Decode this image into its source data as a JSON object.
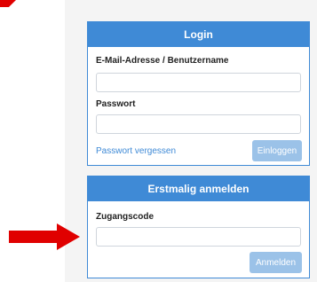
{
  "login": {
    "title": "Login",
    "username_label": "E-Mail-Adresse / Benutzername",
    "username_value": "",
    "password_label": "Passwort",
    "password_value": "",
    "forgot_password": "Passwort vergessen",
    "submit_label": "Einloggen"
  },
  "register": {
    "title": "Erstmalig anmelden",
    "access_code_label": "Zugangscode",
    "access_code_value": "",
    "submit_label": "Anmelden"
  },
  "colors": {
    "accent": "#3f8ad6",
    "button_disabled": "#9bc2e8",
    "annotation_arrow": "#e00000",
    "page_background": "#f4f4f4"
  },
  "icons": {
    "annotation": "red-arrow-icon"
  }
}
